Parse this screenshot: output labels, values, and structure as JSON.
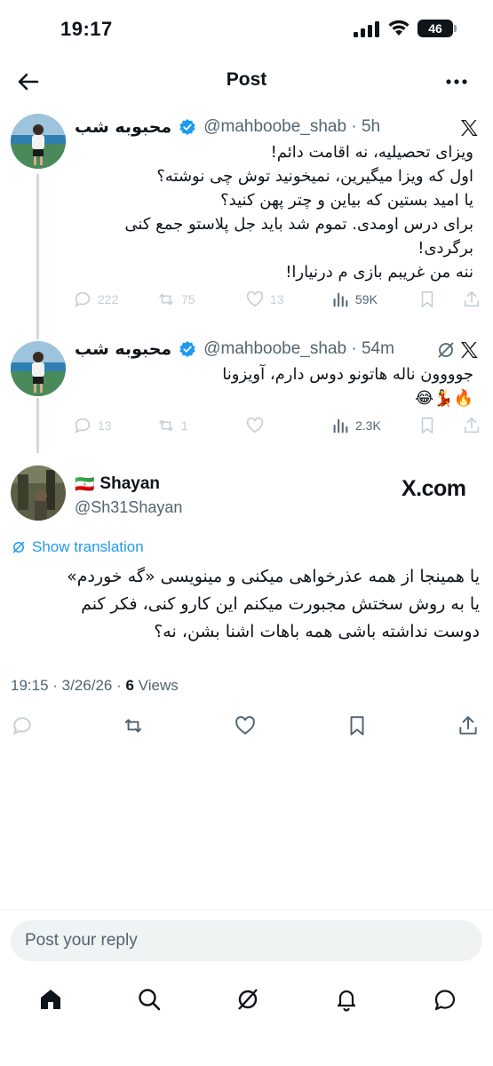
{
  "status_bar": {
    "time": "19:17",
    "battery": "46"
  },
  "header": {
    "title": "Post",
    "back_icon": "arrow-left-icon",
    "more_icon": "more-horizontal-icon"
  },
  "thread": [
    {
      "name": "محبوبه شب",
      "handle": "@mahboobe_shab · 5h",
      "lines": [
        "ویزای تحصیلیه، نه اقامت دائم!",
        "اول که ویزا میگیرین، نمیخونید توش چی نوشته؟",
        "یا امید بستین که بیاین و چتر پهن کنید؟",
        "برای درس اومدی. تموم شد باید جل پلاستو جمع کنی",
        "برگردی!",
        "ننه من غریبم بازی م درنیارا!"
      ],
      "actions": {
        "replies": "222",
        "reposts": "75",
        "likes": "13",
        "views": "59K"
      }
    },
    {
      "name": "محبوبه شب",
      "handle": "@mahboobe_shab · 54m",
      "lines": [
        "جوووون ناله هاتونو دوس دارم، آویزونا",
        "🔥💃😂"
      ],
      "actions": {
        "replies": "13",
        "reposts": "1",
        "likes": "",
        "views": "2.3K"
      }
    }
  ],
  "main_tweet": {
    "flag": "🇮🇷",
    "name": "Shayan",
    "handle": "@Sh31Shayan",
    "watermark": "X.com",
    "show_translation": "Show translation",
    "lines": [
      "یا همینجا از همه عذرخواهی میکنی و مینویسی «گه خوردم»",
      "یا به روش سختش مجبورت میکنم این کارو کنی، فکر کنم",
      "دوست نداشته باشی همه باهات اشنا بشن، نه؟"
    ],
    "timestamp": "19:15 · 3/26/26 · ",
    "views_count": "6",
    "views_label": " Views"
  },
  "reply": {
    "placeholder": "Post your reply"
  },
  "tabbar": {
    "items": [
      "home-icon",
      "search-icon",
      "grok-icon",
      "notifications-icon",
      "messages-icon"
    ]
  }
}
